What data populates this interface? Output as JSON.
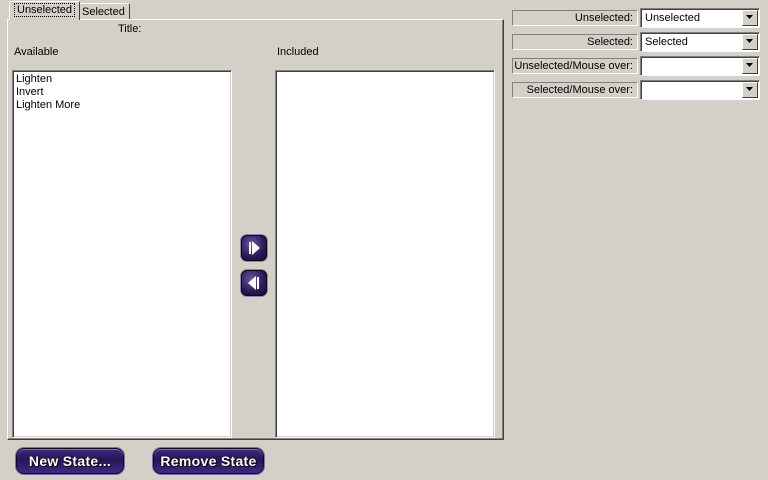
{
  "tabs": [
    {
      "label": "Unselected",
      "active": true
    },
    {
      "label": "Selected",
      "active": false
    }
  ],
  "panel": {
    "title_label": "Title:",
    "available_label": "Available",
    "included_label": "Included",
    "available_items": [
      "Lighten",
      "Invert",
      "Lighten More"
    ],
    "included_items": []
  },
  "arrows": {
    "add_icon": "arrow-right-icon",
    "remove_icon": "arrow-left-icon"
  },
  "state_fields": [
    {
      "label": "Unselected:",
      "value": "Unselected"
    },
    {
      "label": "Selected:",
      "value": "Selected"
    },
    {
      "label": "Unselected/Mouse over:",
      "value": ""
    },
    {
      "label": "Selected/Mouse over:",
      "value": ""
    }
  ],
  "buttons": {
    "new_state": "New State...",
    "remove_state": "Remove State"
  },
  "colors": {
    "background": "#d4d0c8",
    "button_purple": "#2a1a5e"
  }
}
